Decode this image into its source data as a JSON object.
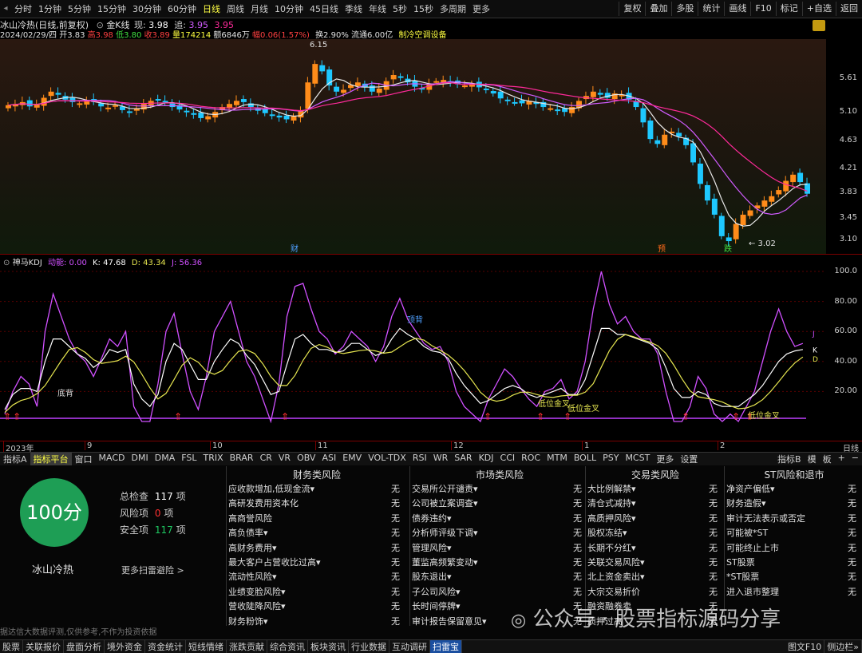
{
  "toolbar": {
    "periods": [
      "分时",
      "1分钟",
      "5分钟",
      "15分钟",
      "30分钟",
      "60分钟",
      "日线",
      "周线",
      "月线",
      "10分钟",
      "45日线",
      "季线",
      "年线",
      "5秒",
      "15秒",
      "多周期",
      "更多"
    ],
    "active_period": "日线",
    "right_buttons": [
      "复权",
      "叠加",
      "多股",
      "统计",
      "画线",
      "F10",
      "标记",
      "+自选",
      "返回"
    ]
  },
  "info": {
    "stock_title": "冰山冷热(日线,前复权)",
    "indicator": "金K线",
    "price_label": "现:",
    "price": "3.98",
    "ma_label": "追:",
    "ma_value": "3.95",
    "ma_value2": "3.95",
    "date": "2024/02/29/四",
    "open": "开3.83",
    "high": "高3.98",
    "low": "低3.80",
    "close": "收3.89",
    "volume": "量174214",
    "amount": "额6846万",
    "change": "幅0.06(1.57%)",
    "turnover": "换2.90%",
    "float": "流通6.00亿",
    "tag": "制冷空调设备"
  },
  "main_axis": [
    "5.61",
    "5.10",
    "4.63",
    "4.21",
    "3.83",
    "3.45",
    "3.10"
  ],
  "annotations": {
    "high_mark": "6.15",
    "low_mark": "3.02",
    "cai": "财",
    "yu": "预",
    "die": "跌"
  },
  "kdj": {
    "title": "神马KDJ",
    "dn_label": "动能:",
    "dn": "0.00",
    "k": "K: 47.68",
    "d": "D: 43.34",
    "j": "J: 56.36",
    "axis": [
      "100.0",
      "80.00",
      "60.00",
      "40.00",
      "20.00"
    ],
    "labels": {
      "dibei": "底背",
      "dingbei": "顶背",
      "jc1": "低位金叉",
      "jc2": "低位金叉",
      "jc3": "低位金叉"
    },
    "months": [
      "2023年",
      "9",
      "10",
      "11",
      "12",
      "1",
      "2"
    ],
    "end_labels": [
      "J",
      "K",
      "D"
    ]
  },
  "tab_bar": {
    "items": [
      "指标A",
      "指标平台",
      "窗口",
      "MACD",
      "DMI",
      "DMA",
      "FSL",
      "TRIX",
      "BRAR",
      "CR",
      "VR",
      "OBV",
      "ASI",
      "EMV",
      "VOL-TDX",
      "RSI",
      "WR",
      "SAR",
      "KDJ",
      "CCI",
      "ROC",
      "MTM",
      "BOLL",
      "PSY",
      "MCST",
      "更多",
      "设置"
    ],
    "active": "指标平台",
    "right": [
      "指标B",
      "模",
      "板",
      "+",
      "−"
    ],
    "date_scroll": "日线"
  },
  "risk": {
    "score": "100分",
    "stock_name": "冰山冷热",
    "total_label": "总检查",
    "total": "117",
    "total_unit": "项",
    "risk_label": "风险项",
    "risk_count": "0",
    "risk_unit": "项",
    "safe_label": "安全项",
    "safe_count": "117",
    "safe_unit": "项",
    "more_link": "更多扫雷避险 >",
    "disclaimer": "据达信大数据评测,仅供参考,不作为投资依据",
    "columns": [
      {
        "title": "财务类风险",
        "items": [
          "应收款增加,低现金流▾",
          "高研发费用资本化",
          "高商誉风险",
          "高负债率▾",
          "高财务费用▾",
          "最大客户占营收比过高▾",
          "流动性风险▾",
          "业绩变脸风险▾",
          "营收陡降风险▾",
          "财务粉饰▾"
        ],
        "values": [
          "无",
          "无",
          "无",
          "无",
          "无",
          "无",
          "无",
          "无",
          "无",
          "无"
        ]
      },
      {
        "title": "市场类风险",
        "items": [
          "交易所公开谴责▾",
          "公司被立案调查▾",
          "债券违约▾",
          "分析师评级下调▾",
          "管理风险▾",
          "董监高频繁变动▾",
          "股东退出▾",
          "子公司风险▾",
          "长时间停牌▾",
          "审计报告保留意见▾"
        ],
        "values": [
          "无",
          "无",
          "无",
          "无",
          "无",
          "无",
          "无",
          "无",
          "无",
          "无"
        ]
      },
      {
        "title": "交易类风险",
        "items": [
          "大比例解禁▾",
          "清仓式减持▾",
          "高质押风险▾",
          "股权冻结▾",
          "长期不分红▾",
          "关联交易风险▾",
          "北上资金卖出▾",
          "大宗交易折价",
          "融资融券卖",
          "质押过高"
        ],
        "values": [
          "无",
          "无",
          "无",
          "无",
          "无",
          "无",
          "无",
          "无",
          "无",
          "无"
        ]
      },
      {
        "title": "ST风险和退市",
        "items": [
          "净资产偏低▾",
          "财务造假▾",
          "审计无法表示或否定",
          "可能被*ST",
          "可能终止上市",
          "ST股票",
          "*ST股票",
          "进入退市整理"
        ],
        "values": [
          "无",
          "无",
          "无",
          "无",
          "无",
          "无",
          "无",
          "无"
        ]
      }
    ]
  },
  "watermark": "公众号 · 股票指标源码分享",
  "bottom_bar": {
    "items": [
      "股票",
      "关联报价",
      "盘面分析",
      "境外资金",
      "资金统计",
      "短线情绪",
      "涨跌贡献",
      "综合资讯",
      "板块资讯",
      "行业数据",
      "互动调研",
      "扫雷宝"
    ],
    "active": "扫雷宝",
    "right": [
      "图文F10",
      "侧边栏»"
    ]
  },
  "colors": {
    "up": "#ff8c1a",
    "down": "#1ec8ff",
    "ma_white": "#e8e8e8",
    "ma_purple": "#d05cff",
    "ma_pink": "#ff2a9a",
    "k_line": "#ffffff",
    "d_line": "#e6e650",
    "j_line": "#d050ff",
    "safe_green": "#1e9e55",
    "risk_red": "#ff3030"
  }
}
